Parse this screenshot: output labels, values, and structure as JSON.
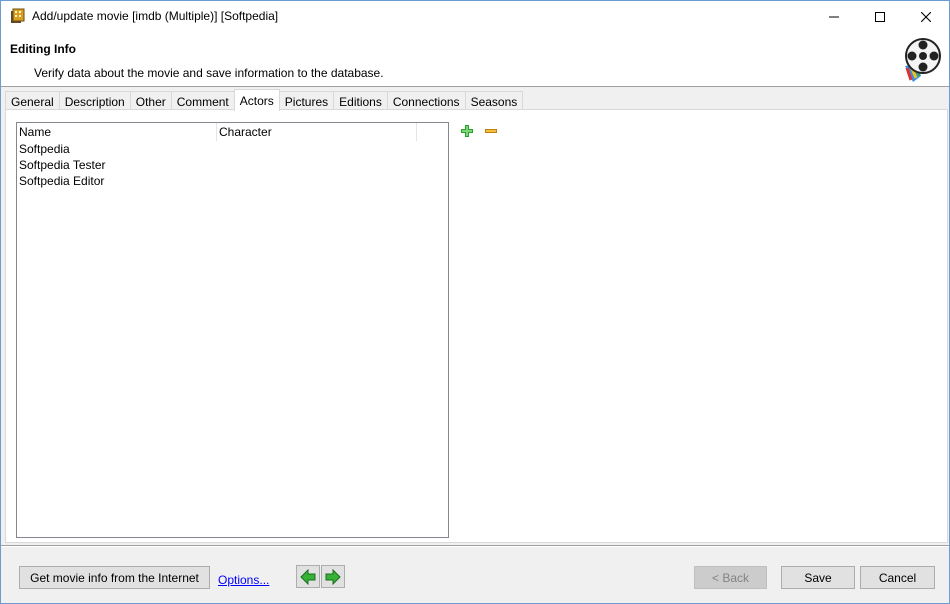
{
  "window": {
    "title": "Add/update movie [imdb (Multiple)] [Softpedia]"
  },
  "header": {
    "title": "Editing Info",
    "subtitle": "Verify data about the movie and save information to the database."
  },
  "tabs": [
    {
      "label": "General"
    },
    {
      "label": "Description"
    },
    {
      "label": "Other"
    },
    {
      "label": "Comment"
    },
    {
      "label": "Actors",
      "active": true
    },
    {
      "label": "Pictures"
    },
    {
      "label": "Editions"
    },
    {
      "label": "Connections"
    },
    {
      "label": "Seasons"
    }
  ],
  "actors": {
    "columns": [
      "Name",
      "Character"
    ],
    "rows": [
      {
        "name": "Softpedia",
        "character": ""
      },
      {
        "name": "Softpedia Tester",
        "character": ""
      },
      {
        "name": "Softpedia Editor",
        "character": ""
      }
    ]
  },
  "footer": {
    "get_info_label": "Get movie info from the Internet",
    "options_label": "Options...",
    "back_label": "< Back",
    "save_label": "Save",
    "cancel_label": "Cancel"
  },
  "icons": {
    "add": "plus-icon",
    "remove": "minus-icon",
    "prev": "arrow-left-icon",
    "next": "arrow-right-icon"
  },
  "colors": {
    "add_green": "#2e9e2e",
    "remove_orange": "#e0a020",
    "nav_green": "#36b336",
    "link_blue": "#0000ff"
  }
}
